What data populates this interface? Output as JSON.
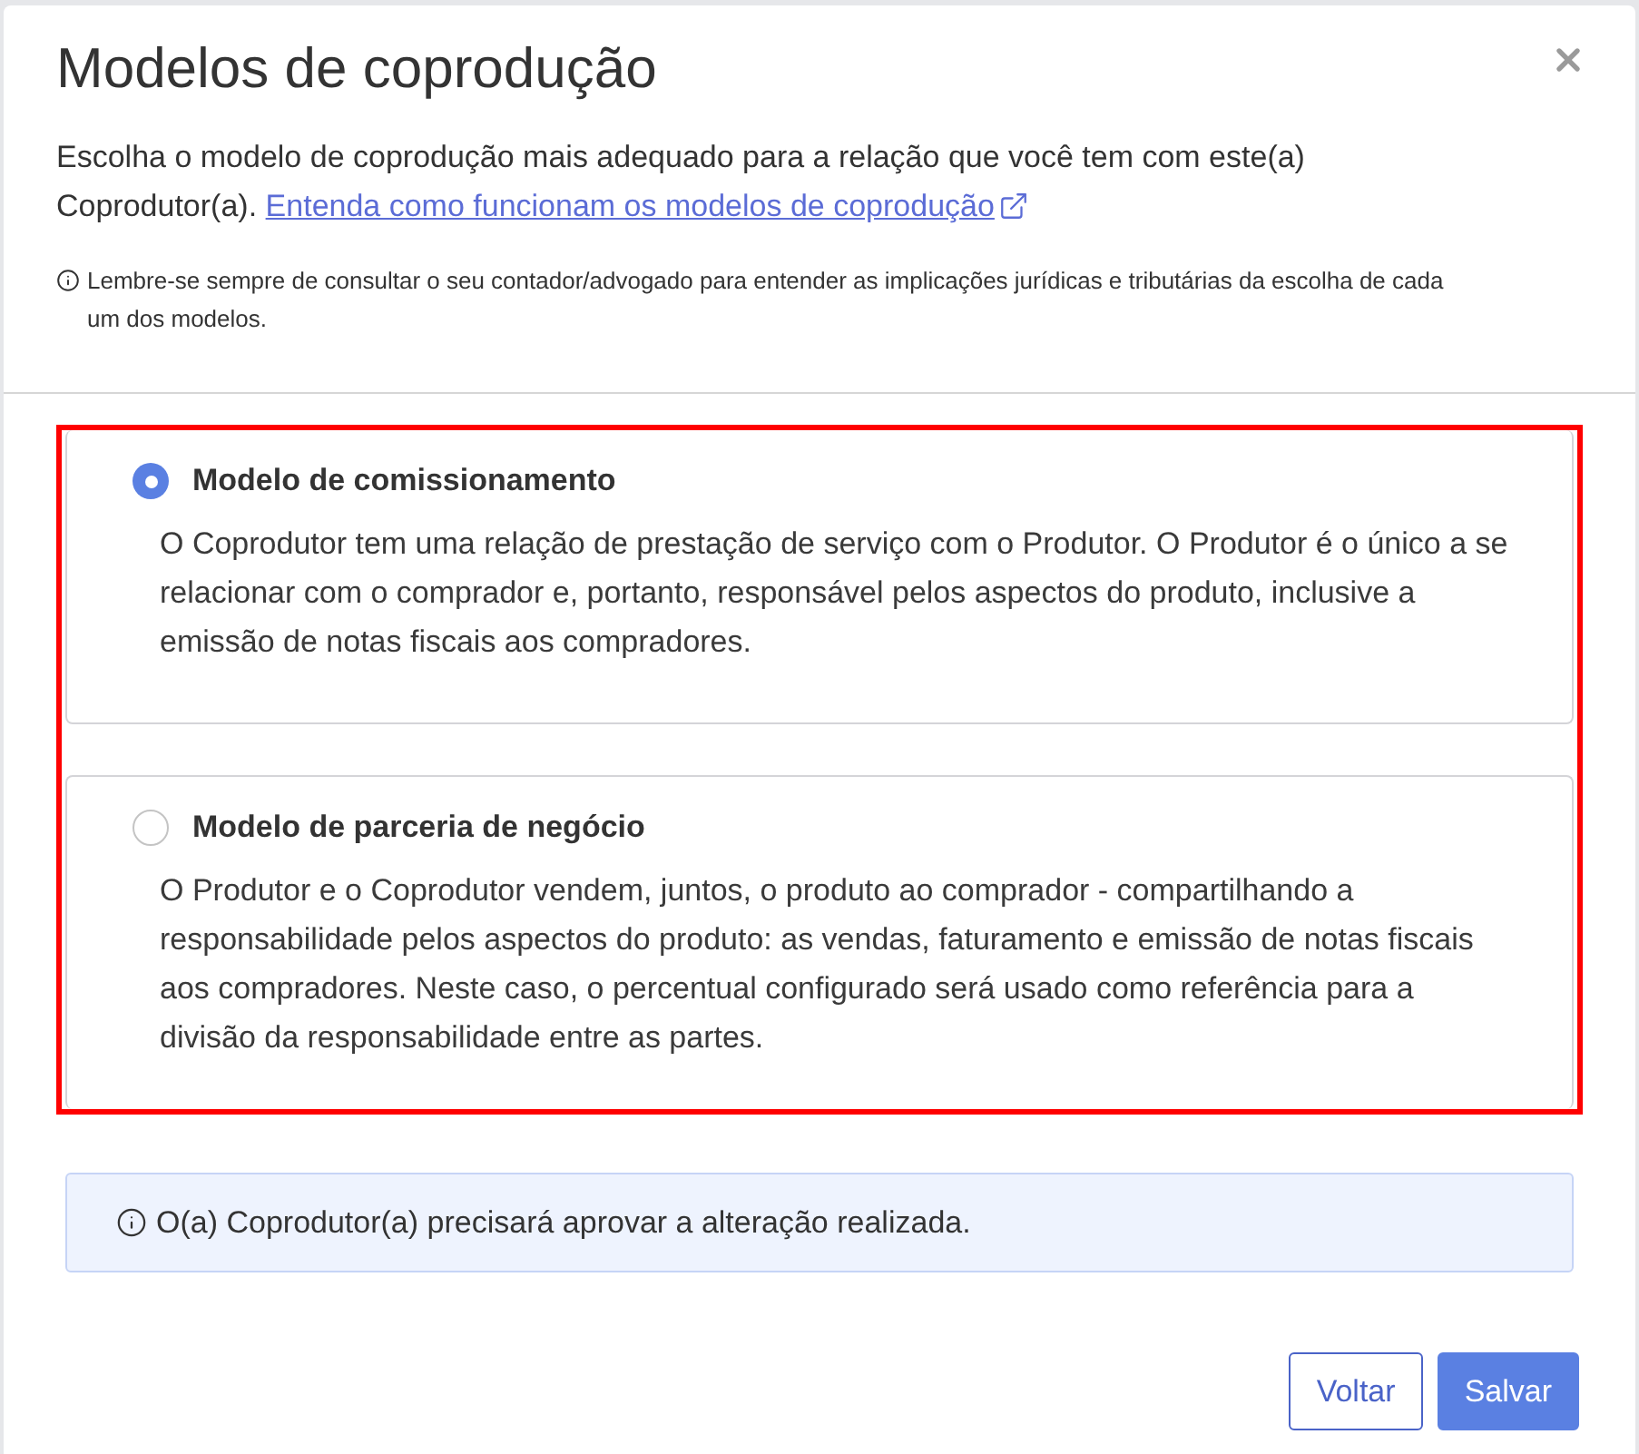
{
  "dialog": {
    "title": "Modelos de coprodução"
  },
  "intro": {
    "text": "Escolha o modelo de coprodução mais adequado para a relação que você tem com este(a) Coprodutor(a).",
    "link": "Entenda como funcionam os modelos de coprodução"
  },
  "note": "Lembre-se sempre de consultar o seu contador/advogado para entender as implicações jurídicas e tributárias da escolha de cada um dos modelos.",
  "options": [
    {
      "title": "Modelo de comissionamento",
      "description": "O Coprodutor tem uma relação de prestação de serviço com o Produtor. O Produtor é o único a se relacionar com o comprador e, portanto, responsável pelos aspectos do produto, inclusive a emissão de notas fiscais aos compradores.",
      "selected": true
    },
    {
      "title": "Modelo de parceria de negócio",
      "description": "O Produtor e o Coprodutor vendem, juntos, o produto ao comprador - compartilhando a responsabilidade pelos aspectos do produto: as vendas, faturamento e emissão de notas fiscais aos compradores. Neste caso, o percentual configurado será usado como referência para a divisão da responsabilidade entre as partes.",
      "selected": false
    }
  ],
  "alert": "O(a) Coprodutor(a) precisará aprovar a alteração realizada.",
  "buttons": [
    {
      "label": "Voltar",
      "kind": "secondary"
    },
    {
      "label": "Salvar",
      "kind": "primary"
    }
  ]
}
